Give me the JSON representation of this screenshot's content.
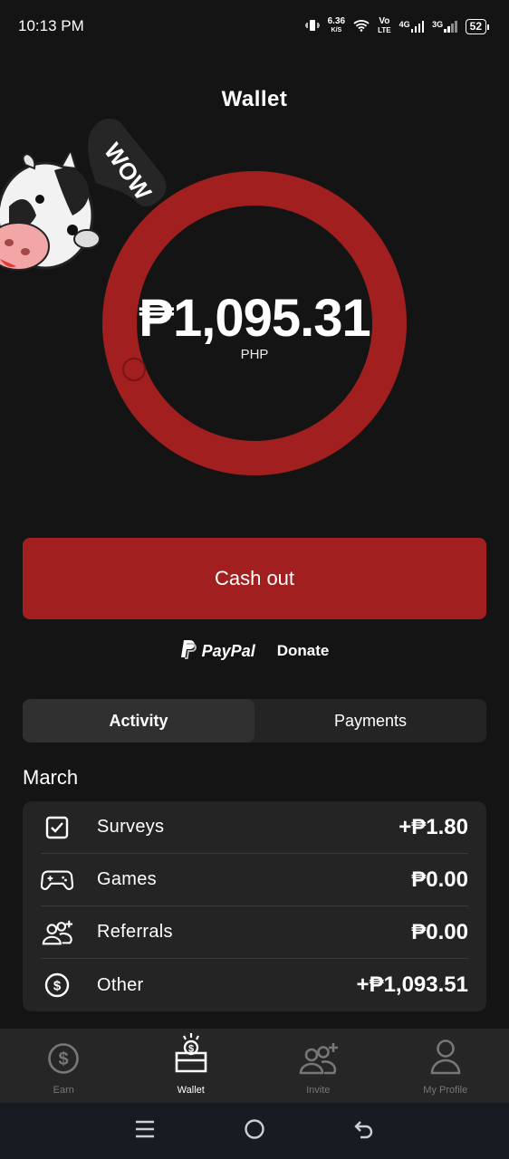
{
  "status_bar": {
    "time": "10:13 PM",
    "net_speed_value": "6.36",
    "net_speed_unit": "K/S",
    "volte_top": "Vo",
    "volte_bottom": "LTE",
    "sim1_type": "4G",
    "sim2_type": "3G",
    "battery": "52"
  },
  "header": {
    "title": "Wallet"
  },
  "sticker": {
    "text": "WOW"
  },
  "balance": {
    "amount": "₱1,095.31",
    "currency": "PHP"
  },
  "cashout": {
    "label": "Cash out"
  },
  "paypal": {
    "brand": "PayPal",
    "donate_label": "Donate"
  },
  "tabs": [
    {
      "label": "Activity",
      "active": true
    },
    {
      "label": "Payments",
      "active": false
    }
  ],
  "activity": {
    "month": "March",
    "rows": [
      {
        "icon": "checkbox-icon",
        "label": "Surveys",
        "value": "+₱1.80"
      },
      {
        "icon": "gamepad-icon",
        "label": "Games",
        "value": "₱0.00"
      },
      {
        "icon": "add-users-icon",
        "label": "Referrals",
        "value": "₱0.00"
      },
      {
        "icon": "dollar-coin-icon",
        "label": "Other",
        "value": "+₱1,093.51"
      }
    ]
  },
  "bottom_nav": [
    {
      "icon": "dollar-coin-icon",
      "label": "Earn",
      "active": false
    },
    {
      "icon": "wallet-icon",
      "label": "Wallet",
      "active": true
    },
    {
      "icon": "invite-icon",
      "label": "Invite",
      "active": false
    },
    {
      "icon": "profile-icon",
      "label": "My Profile",
      "active": false
    }
  ],
  "colors": {
    "background": "#141414",
    "accent_red": "#a21f1f",
    "card": "#242424",
    "inactive": "#777777"
  }
}
